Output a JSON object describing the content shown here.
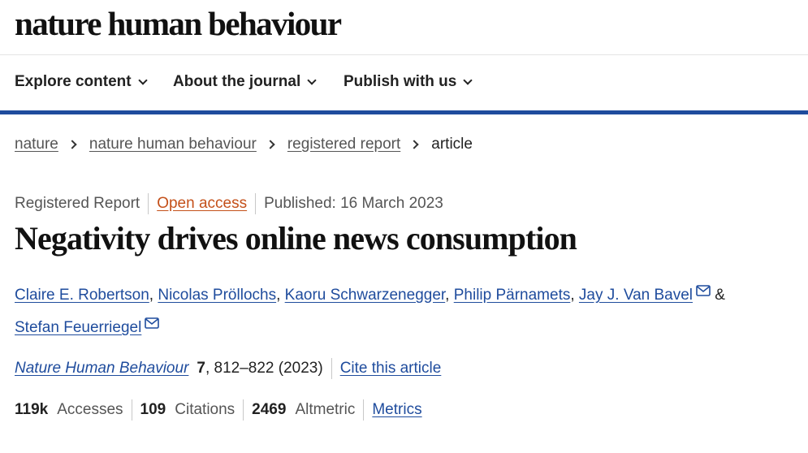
{
  "header": {
    "logo": "nature human behaviour"
  },
  "nav": {
    "items": [
      {
        "label": "Explore content"
      },
      {
        "label": "About the journal"
      },
      {
        "label": "Publish with us"
      }
    ]
  },
  "breadcrumb": {
    "items": [
      "nature",
      "nature human behaviour",
      "registered report"
    ],
    "current": "article"
  },
  "article": {
    "type": "Registered Report",
    "access": "Open access",
    "published": "Published: 16 March 2023",
    "title": "Negativity drives online news consumption",
    "authors": [
      {
        "name": "Claire E. Robertson",
        "sep": ", "
      },
      {
        "name": "Nicolas Pröllochs",
        "sep": ", "
      },
      {
        "name": "Kaoru Schwarzenegger",
        "sep": ", "
      },
      {
        "name": "Philip Pärnamets",
        "sep": ", "
      },
      {
        "name": "Jay J. Van Bavel",
        "sep": " & "
      },
      {
        "name": "Stefan Feuerriegel",
        "sep": ""
      }
    ],
    "journal": "Nature Human Behaviour",
    "volume": "7",
    "pages": ", 812–822 (2023)",
    "cite_label": "Cite this article"
  },
  "metrics": {
    "accesses_value": "119k",
    "accesses_label": "Accesses",
    "citations_value": "109",
    "citations_label": "Citations",
    "altmetric_value": "2469",
    "altmetric_label": "Altmetric",
    "metrics_link": "Metrics"
  },
  "colors": {
    "link_blue": "#1f4c9d",
    "open_access_orange": "#c4501a",
    "nav_bar": "#1f4c9d"
  }
}
